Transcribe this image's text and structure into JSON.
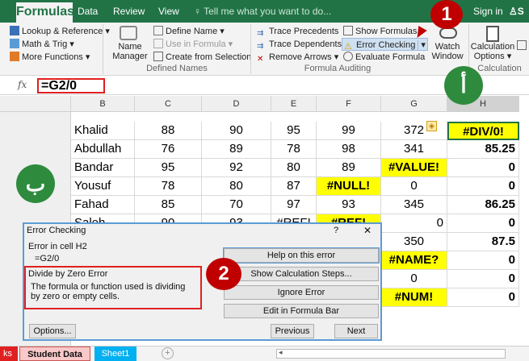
{
  "ribbon": {
    "tabs": [
      "Formulas",
      "Data",
      "Review",
      "View"
    ],
    "tell_me": "Tell me what you want to do...",
    "sign_in": "Sign in",
    "share": "S",
    "lookup": "Lookup & Reference",
    "math": "Math & Trig",
    "more": "More Functions",
    "define_name": "Define Name",
    "use_in_formula": "Use in Formula",
    "create_from_selection": "Create from Selection",
    "name_manager_1": "Name",
    "name_manager_2": "Manager",
    "group_defined_names": "Defined Names",
    "trace_precedents": "Trace Precedents",
    "trace_dependents": "Trace Dependents",
    "remove_arrows": "Remove Arrows",
    "show_formulas": "Show Formulas",
    "error_checking": "Error Checking",
    "evaluate_formula": "Evaluate Formula",
    "watch_1": "Watch",
    "watch_2": "Window",
    "group_formula_auditing": "Formula Auditing",
    "calc_options_1": "Calculation",
    "calc_options_2": "Options",
    "group_calculation": "Calculation"
  },
  "formula_bar": {
    "fx": "fx",
    "formula": "=G2/0"
  },
  "columns": [
    "B",
    "C",
    "D",
    "E",
    "F",
    "G",
    "H"
  ],
  "rows": [
    [
      "Khalid",
      "88",
      "90",
      "95",
      "99",
      "372",
      "#DIV/0!"
    ],
    [
      "Abdullah",
      "76",
      "89",
      "78",
      "98",
      "341",
      "85.25"
    ],
    [
      "Bandar",
      "95",
      "92",
      "80",
      "89",
      "#VALUE!",
      "0"
    ],
    [
      "Yousuf",
      "78",
      "80",
      "87",
      "#NULL!",
      "0",
      "0"
    ],
    [
      "Fahad",
      "85",
      "70",
      "97",
      "93",
      "345",
      "86.25"
    ],
    [
      "Saleh",
      "90",
      "93",
      "#REF!",
      "#REF!",
      "0",
      "0"
    ],
    [
      "",
      "",
      "",
      "",
      "",
      "350",
      "87.5"
    ],
    [
      "",
      "",
      "",
      "",
      "",
      "#NAME?",
      "0"
    ],
    [
      "",
      "",
      "",
      "",
      "",
      "0",
      "0"
    ],
    [
      "",
      "",
      "",
      "",
      "",
      "#NUM!",
      "0"
    ]
  ],
  "dialog": {
    "title": "Error Checking",
    "question": "?",
    "close": "✕",
    "error_in": "Error in cell H2",
    "formula": "=G2/0",
    "error_name": "Divide by Zero Error",
    "error_desc": "The formula or function used is dividing by zero or empty cells.",
    "help": "Help on this error",
    "show_steps": "Show Calculation Steps...",
    "ignore": "Ignore Error",
    "edit": "Edit in Formula Bar",
    "options": "Options...",
    "previous": "Previous",
    "next": "Next"
  },
  "sheet_tabs": [
    "ks",
    "Student Data",
    "Sheet1"
  ],
  "add_sheet": "+",
  "annotations": {
    "one": "1",
    "two": "2",
    "alif": "أ",
    "ba": "ب"
  },
  "colors": {
    "excel_green": "#217346",
    "error_yellow": "#ffff00",
    "annotation_red": "#c00000",
    "annotation_green": "#2e8b3e"
  }
}
